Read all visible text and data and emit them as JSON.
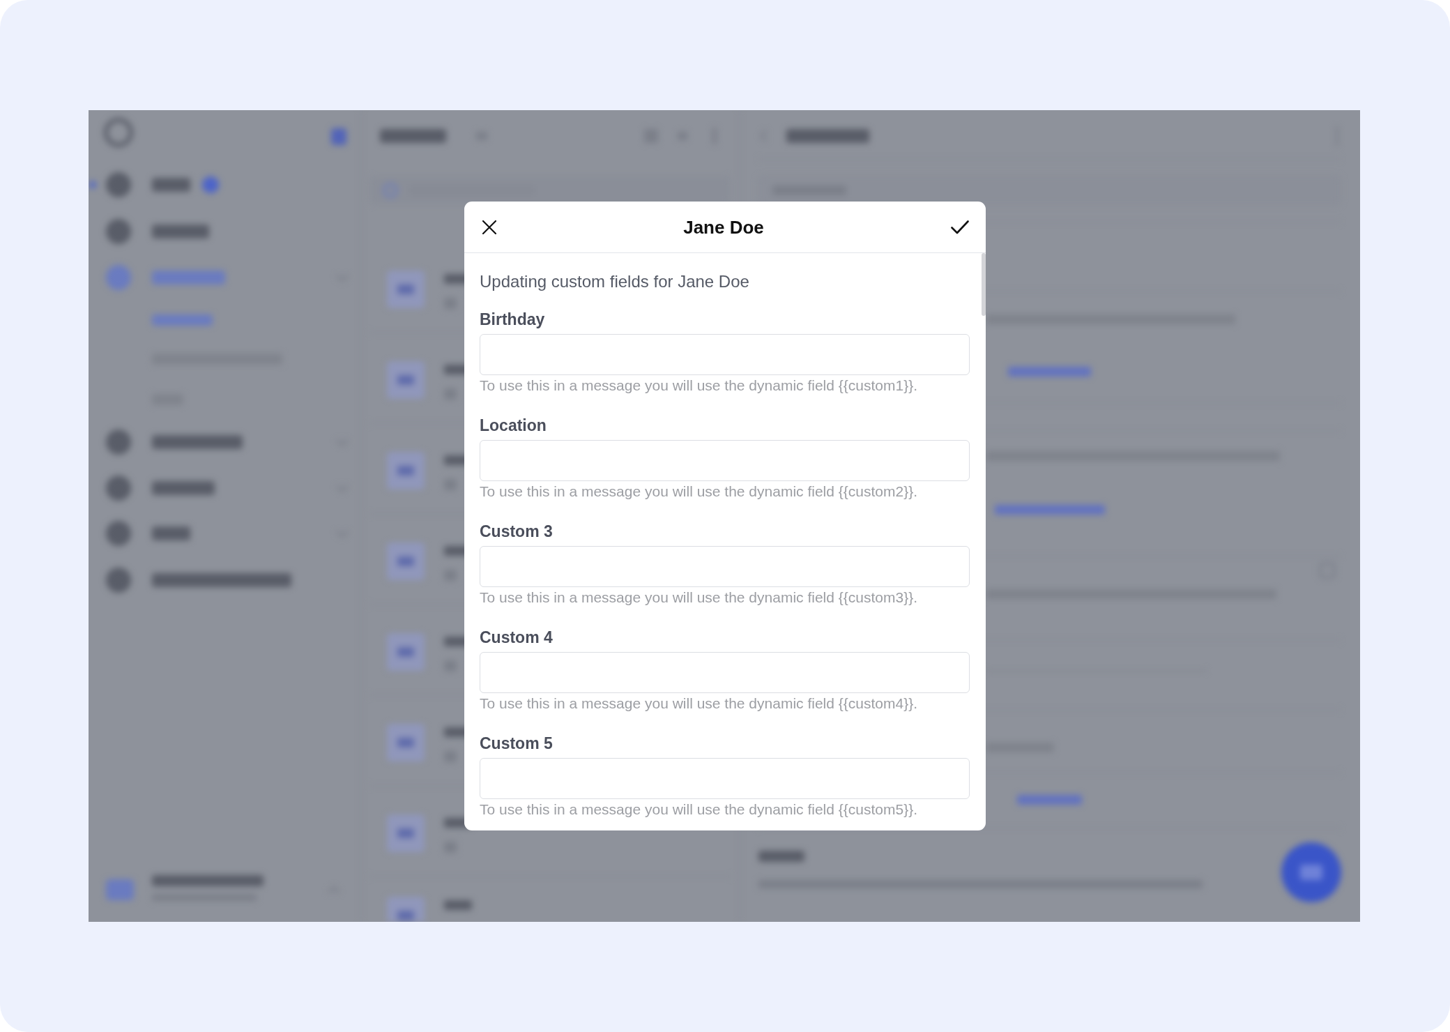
{
  "dialog": {
    "title": "Jane Doe",
    "subtitle": "Updating custom fields for Jane Doe",
    "fields": [
      {
        "label": "Birthday",
        "hint": "To use this in a message you will use the dynamic field {{custom1}}."
      },
      {
        "label": "Location",
        "hint": "To use this in a message you will use the dynamic field {{custom2}}."
      },
      {
        "label": "Custom 3",
        "hint": "To use this in a message you will use the dynamic field {{custom3}}."
      },
      {
        "label": "Custom 4",
        "hint": "To use this in a message you will use the dynamic field {{custom4}}."
      },
      {
        "label": "Custom 5",
        "hint": "To use this in a message you will use the dynamic field {{custom5}}."
      }
    ]
  }
}
